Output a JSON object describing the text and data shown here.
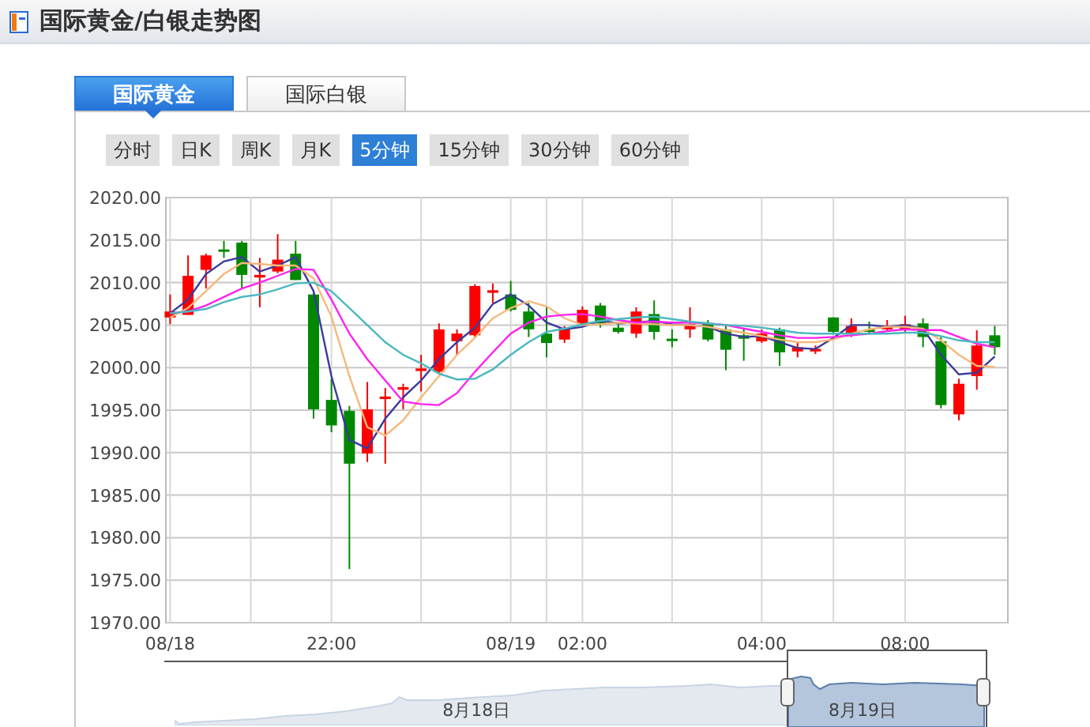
{
  "header": {
    "title": "国际黄金/白银走势图"
  },
  "tabs": [
    {
      "label": "国际黄金",
      "selected": true
    },
    {
      "label": "国际白银",
      "selected": false
    }
  ],
  "periods": [
    {
      "label": "分时",
      "selected": false
    },
    {
      "label": "日K",
      "selected": false
    },
    {
      "label": "周K",
      "selected": false
    },
    {
      "label": "月K",
      "selected": false
    },
    {
      "label": "5分钟",
      "selected": true
    },
    {
      "label": "15分钟",
      "selected": false
    },
    {
      "label": "30分钟",
      "selected": false
    },
    {
      "label": "60分钟",
      "selected": false
    }
  ],
  "chart": {
    "chart_data": {
      "type": "candlestick",
      "grid": true,
      "categories": [
        "08/18",
        null,
        null,
        null,
        null,
        null,
        null,
        null,
        null,
        "22:00",
        null,
        null,
        null,
        null,
        null,
        null,
        null,
        null,
        null,
        "08/19",
        null,
        null,
        null,
        "02:00",
        null,
        null,
        null,
        null,
        null,
        null,
        null,
        null,
        null,
        "04:00",
        null,
        null,
        null,
        null,
        null,
        null,
        null,
        "08:00",
        null,
        null,
        null,
        null,
        null
      ],
      "ylim": [
        1970,
        2020
      ],
      "yticks": [
        {
          "value": 2020,
          "label": "2020.00"
        },
        {
          "value": 2015,
          "label": "2015.00"
        },
        {
          "value": 2010,
          "label": "2010.00"
        },
        {
          "value": 2005,
          "label": "2005.00"
        },
        {
          "value": 2000,
          "label": "2000.00"
        },
        {
          "value": 1995,
          "label": "1995.00"
        },
        {
          "value": 1990,
          "label": "1990.00"
        },
        {
          "value": 1985,
          "label": "1985.00"
        },
        {
          "value": 1980,
          "label": "1980.00"
        },
        {
          "value": 1975,
          "label": "1975.00"
        },
        {
          "value": 1970,
          "label": "1970.00"
        }
      ],
      "ohlc": [
        [
          2005.9,
          2008.6,
          2005.1,
          2006.6
        ],
        [
          2006.2,
          2013.2,
          2006.2,
          2010.8
        ],
        [
          2011.5,
          2013.4,
          2009.3,
          2013.2
        ],
        [
          2013.9,
          2014.9,
          2012.9,
          2013.7
        ],
        [
          2014.7,
          2014.9,
          2009.3,
          2010.9
        ],
        [
          2010.6,
          2012.9,
          2007.1,
          2010.9
        ],
        [
          2011.3,
          2015.7,
          2011.1,
          2012.7
        ],
        [
          2013.4,
          2014.9,
          2010.3,
          2010.3
        ],
        [
          2008.6,
          2008.8,
          1994.0,
          1995.1
        ],
        [
          1996.2,
          1998.7,
          1992.4,
          1993.2
        ],
        [
          1994.9,
          1995.5,
          1976.3,
          1988.7
        ],
        [
          1989.9,
          1998.3,
          1988.9,
          1995.1
        ],
        [
          1996.3,
          1997.6,
          1988.7,
          1996.6
        ],
        [
          1997.4,
          1998.1,
          1995.1,
          1997.7
        ],
        [
          1999.6,
          2001.5,
          1997.2,
          1999.9
        ],
        [
          1999.5,
          2005.2,
          1999.4,
          2004.5
        ],
        [
          2003.1,
          2004.5,
          2001.5,
          2004.0
        ],
        [
          2003.8,
          2009.8,
          2003.6,
          2009.6
        ],
        [
          2008.8,
          2009.9,
          2007.6,
          2009.1
        ],
        [
          2008.6,
          2010.2,
          2006.6,
          2006.8
        ],
        [
          2006.6,
          2007.6,
          2003.6,
          2004.5
        ],
        [
          2004.0,
          2007.2,
          2001.2,
          2002.9
        ],
        [
          2003.3,
          2004.9,
          2002.9,
          2004.7
        ],
        [
          2005.1,
          2007.2,
          2004.9,
          2006.8
        ],
        [
          2007.3,
          2007.6,
          2004.7,
          2005.2
        ],
        [
          2004.7,
          2005.1,
          2004.0,
          2004.2
        ],
        [
          2004.0,
          2007.1,
          2003.5,
          2006.6
        ],
        [
          2006.3,
          2007.9,
          2003.3,
          2004.2
        ],
        [
          2003.4,
          2004.5,
          2002.4,
          2003.2
        ],
        [
          2004.5,
          2007.1,
          2003.5,
          2005.1
        ],
        [
          2005.2,
          2005.6,
          2003.1,
          2003.3
        ],
        [
          2004.5,
          2005.1,
          1999.7,
          2002.1
        ],
        [
          2003.8,
          2004.5,
          2000.8,
          2003.4
        ],
        [
          2003.1,
          2004.5,
          2002.9,
          2004.0
        ],
        [
          2004.5,
          2004.7,
          2000.2,
          2001.8
        ],
        [
          2001.9,
          2002.9,
          2001.2,
          2002.4
        ],
        [
          2001.9,
          2002.6,
          2001.6,
          2002.2
        ],
        [
          2005.9,
          2005.9,
          2004.0,
          2004.2
        ],
        [
          2003.8,
          2005.8,
          2003.6,
          2004.9
        ],
        [
          2004.5,
          2005.4,
          2004.0,
          2004.2
        ],
        [
          2004.5,
          2005.6,
          2004.4,
          2004.9
        ],
        [
          2004.5,
          2006.1,
          2004.2,
          2005.1
        ],
        [
          2005.2,
          2005.8,
          2002.4,
          2003.6
        ],
        [
          2003.1,
          2003.6,
          1995.2,
          1995.6
        ],
        [
          1994.5,
          1998.7,
          1993.8,
          1998.1
        ],
        [
          1999.0,
          2004.4,
          1997.4,
          2002.6
        ],
        [
          2003.8,
          2004.9,
          2001.5,
          2002.4
        ]
      ],
      "series": [
        {
          "type": "line",
          "color": "#3a3a9a",
          "values": [
            2006.4,
            2008,
            2011,
            2012.5,
            2013,
            2011.3,
            2012,
            2013,
            2009,
            1999,
            1991.5,
            1990.5,
            1994,
            1996.5,
            1998.5,
            2001,
            2003,
            2004.7,
            2007.5,
            2008.6,
            2007.3,
            2005.3,
            2004.5,
            2004.8,
            2005.5,
            2005.2,
            2005.3,
            2005.5,
            2005.1,
            2005,
            2004.8,
            2004,
            2003.6,
            2003.7,
            2003,
            2002.3,
            2002.2,
            2003.5,
            2005,
            2005,
            2004.8,
            2005,
            2004.6,
            2001.5,
            1999.2,
            1999.4,
            2001.3
          ]
        },
        {
          "type": "line",
          "color": "#f5b87a",
          "values": [
            2005.9,
            2007,
            2009,
            2011,
            2012.3,
            2012.2,
            2012,
            2012,
            2010.5,
            2006,
            1999,
            1993,
            1992,
            1993.8,
            1996.5,
            1999,
            2001.5,
            2003.5,
            2005.8,
            2007,
            2007.8,
            2007.2,
            2005.8,
            2005,
            2005.1,
            2005.3,
            2005.2,
            2005.1,
            2005,
            2005,
            2004.8,
            2004.4,
            2004.1,
            2003.7,
            2003.3,
            2003,
            2003,
            2003.3,
            2004,
            2004.5,
            2004.8,
            2004.8,
            2004.6,
            2003.2,
            2001.5,
            2000.2,
            2000.1
          ]
        },
        {
          "type": "line",
          "color": "#ff22ee",
          "values": [
            2006.4,
            2006.6,
            2007.3,
            2008.3,
            2009.3,
            2010,
            2010.8,
            2011.6,
            2011.5,
            2008,
            2004,
            2001,
            1998.5,
            1996,
            1995.7,
            1995.6,
            1997,
            1999.5,
            2001.8,
            2004,
            2005.3,
            2006,
            2006.2,
            2006.3,
            2006,
            2005.6,
            2005.3,
            2005.4,
            2005.3,
            2005.3,
            2005.2,
            2005,
            2004.6,
            2004.2,
            2003.8,
            2003.5,
            2003.5,
            2003.6,
            2003.8,
            2004,
            2004.3,
            2004.5,
            2004.4,
            2004.4,
            2003.6,
            2002.8,
            2002.4
          ]
        },
        {
          "type": "line",
          "color": "#4ab8c0",
          "values": [
            2006.4,
            2006.6,
            2006.9,
            2007.7,
            2008.3,
            2008.6,
            2009.2,
            2009.9,
            2010,
            2009,
            2007,
            2005,
            2003,
            2001.5,
            2000.5,
            1999.3,
            1998.6,
            1998.7,
            1999.8,
            2001.5,
            2003,
            2004.2,
            2004.6,
            2005.1,
            2005.5,
            2005.7,
            2005.9,
            2006,
            2005.7,
            2005.4,
            2005.2,
            2005,
            2004.9,
            2004.7,
            2004.4,
            2004.1,
            2004,
            2004,
            2004,
            2004,
            2004,
            2004.1,
            2004.1,
            2003.7,
            2003.2,
            2003,
            2003
          ]
        }
      ]
    }
  },
  "navigator": {
    "dates": [
      "8月18日",
      "8月19日"
    ]
  }
}
